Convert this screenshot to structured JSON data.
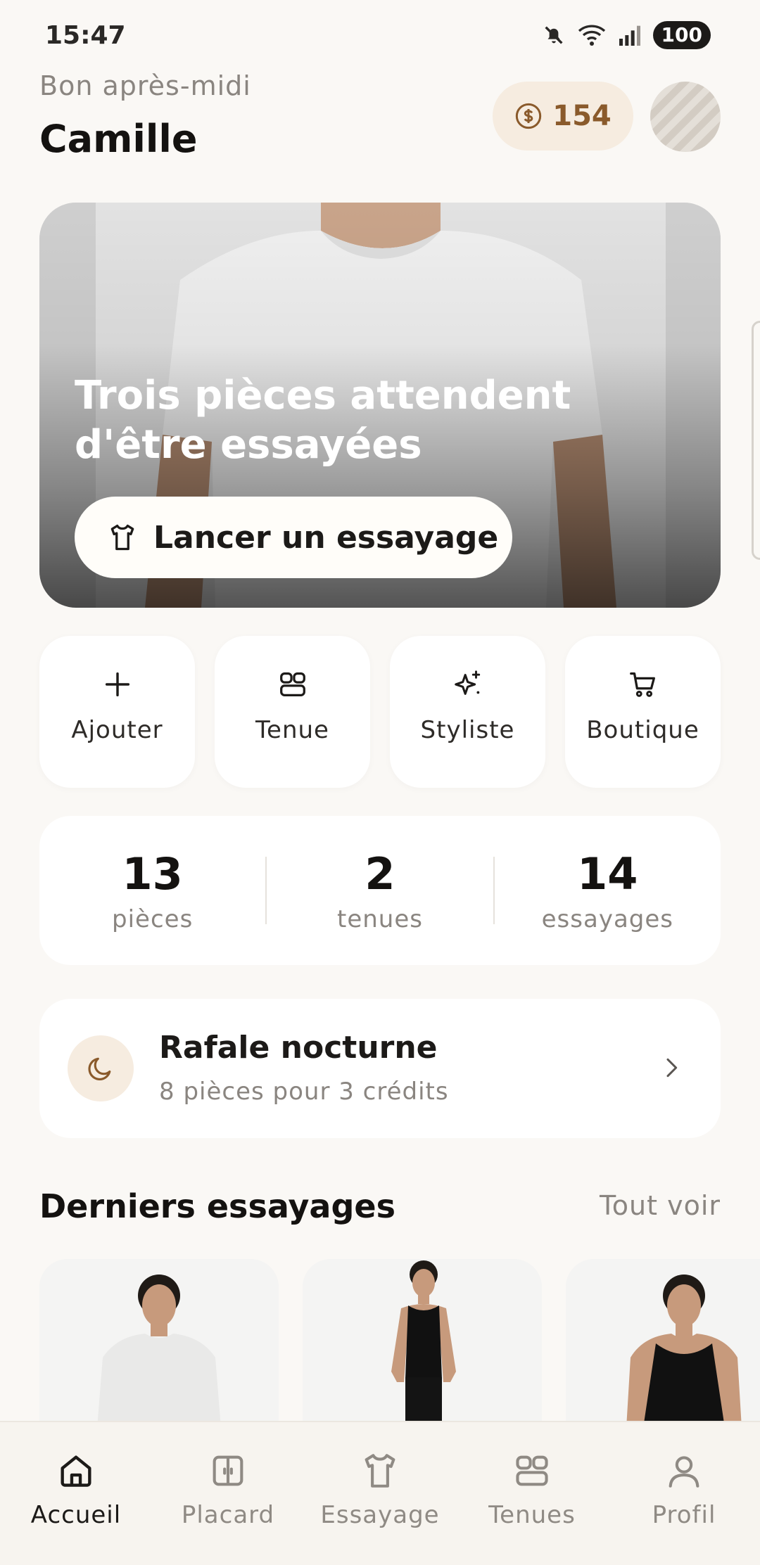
{
  "status_bar": {
    "time": "15:47",
    "battery": "100"
  },
  "header": {
    "greeting": "Bon après-midi",
    "username": "Camille",
    "credits": "154"
  },
  "hero": {
    "title": "Trois pièces attendent d'être essayées",
    "cta_label": "Lancer un essayage"
  },
  "quick_actions": [
    {
      "label": "Ajouter",
      "icon": "plus-icon"
    },
    {
      "label": "Tenue",
      "icon": "outfit-grid-icon"
    },
    {
      "label": "Styliste",
      "icon": "sparkle-icon"
    },
    {
      "label": "Boutique",
      "icon": "cart-icon"
    }
  ],
  "stats": [
    {
      "value": "13",
      "label": "pièces"
    },
    {
      "value": "2",
      "label": "tenues"
    },
    {
      "value": "14",
      "label": "essayages"
    }
  ],
  "promo": {
    "title": "Rafale nocturne",
    "subtitle": "8 pièces pour 3 crédits",
    "icon": "moon-icon"
  },
  "recent": {
    "title": "Derniers essayages",
    "see_all": "Tout voir"
  },
  "bottom_nav": [
    {
      "label": "Accueil",
      "icon": "home-icon",
      "active": true
    },
    {
      "label": "Placard",
      "icon": "wardrobe-icon",
      "active": false
    },
    {
      "label": "Essayage",
      "icon": "tshirt-icon",
      "active": false
    },
    {
      "label": "Tenues",
      "icon": "outfit-grid-icon",
      "active": false
    },
    {
      "label": "Profil",
      "icon": "user-icon",
      "active": false
    }
  ],
  "colors": {
    "accent": "#8a5a2b",
    "accent_bg": "#f6ece0",
    "background": "#faf8f5"
  }
}
